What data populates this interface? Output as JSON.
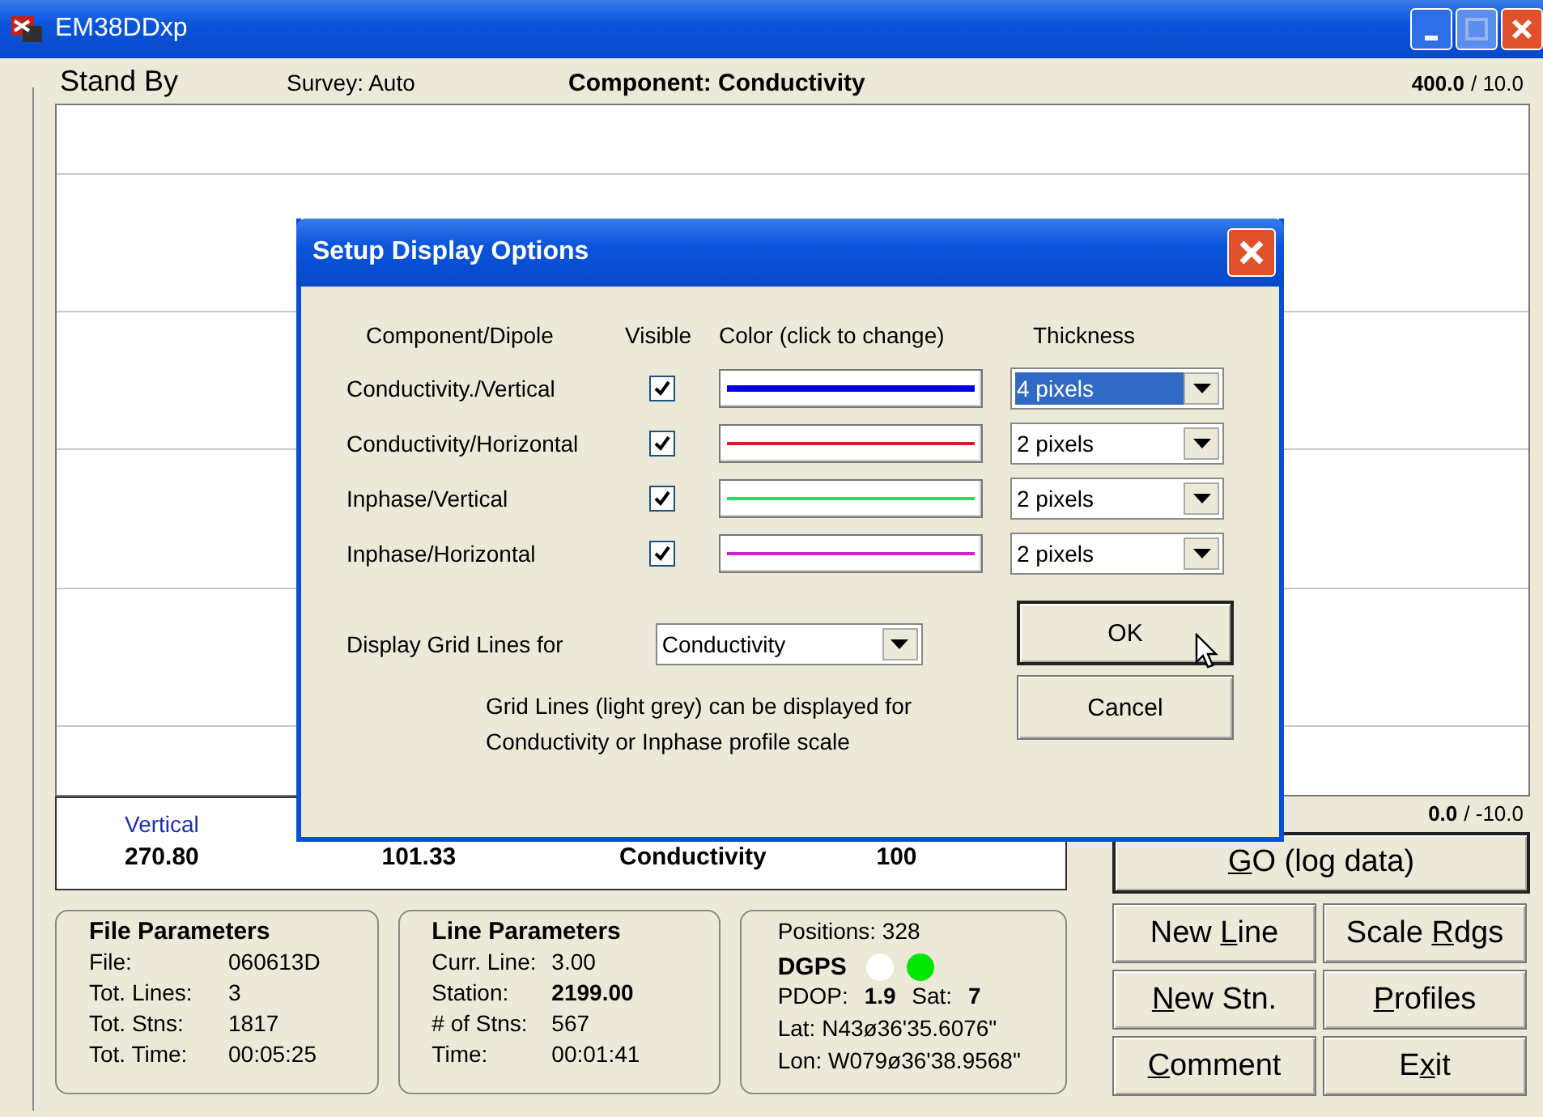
{
  "window": {
    "title": "EM38DDxp"
  },
  "header": {
    "status": "Stand By",
    "survey": "Survey: Auto",
    "component": "Component: Conductivity",
    "scale_top": {
      "value": "400.0",
      "range": "/ 10.0"
    }
  },
  "scale_bottom": {
    "value": "0.0",
    "range": "/ -10.0"
  },
  "readings": [
    {
      "heading": "Vertical",
      "value": "270.80"
    },
    {
      "value": "101.33"
    },
    {
      "value": "Conductivity"
    },
    {
      "value": "100"
    }
  ],
  "file_parameters": {
    "title": "File Parameters",
    "rows": [
      {
        "label": "File:",
        "value": "060613D",
        "bold": false
      },
      {
        "label": "Tot. Lines:",
        "value": "3",
        "bold": false
      },
      {
        "label": "Tot. Stns:",
        "value": "1817",
        "bold": false
      },
      {
        "label": "Tot. Time:",
        "value": "00:05:25",
        "bold": false
      }
    ]
  },
  "line_parameters": {
    "title": "Line Parameters",
    "rows": [
      {
        "label": "Curr. Line:",
        "value": "3.00",
        "bold": false
      },
      {
        "label": "Station:",
        "value": "2199.00",
        "bold": true
      },
      {
        "label": "# of Stns:",
        "value": "567",
        "bold": false
      },
      {
        "label": "Time:",
        "value": "00:01:41",
        "bold": false
      }
    ]
  },
  "gps": {
    "positions": "Positions: 328",
    "label": "DGPS",
    "lamps": [
      {
        "color": "#ffffff"
      },
      {
        "color": "#00e600"
      }
    ],
    "pdop": "PDOP: **1.9**    Sat: **7**",
    "lat": "Lat:  N43ø36'35.6076\"",
    "lon": "Lon: W079ø36'38.9568\""
  },
  "go_button": {
    "key": "G",
    "post": "O (log data)"
  },
  "buttons": [
    {
      "pre": "New ",
      "key": "L",
      "post": "ine"
    },
    {
      "pre": "Scale ",
      "key": "R",
      "post": "dgs"
    },
    {
      "key": "N",
      "post": "ew Stn."
    },
    {
      "key": "P",
      "post": "rofiles"
    },
    {
      "key": "C",
      "post": "omment"
    },
    {
      "pre": "E",
      "key": "x",
      "post": "it"
    }
  ],
  "dialog": {
    "title": "Setup Display Options",
    "columns": [
      "Component/Dipole",
      "Visible",
      "Color (click to change)",
      "Thickness"
    ],
    "rows": [
      {
        "label": "Conductivity./Vertical",
        "visible": true,
        "color": "#0000e6",
        "kind": "thick",
        "thickness": "4 pixels",
        "selected": true
      },
      {
        "label": "Conductivity/Horizontal",
        "visible": true,
        "color": "#d0202a",
        "kind": "thin",
        "thickness": "2 pixels",
        "selected": false
      },
      {
        "label": "Inphase/Vertical",
        "visible": true,
        "color": "#20e060",
        "kind": "thin",
        "thickness": "2 pixels",
        "selected": false
      },
      {
        "label": "Inphase/Horizontal",
        "visible": true,
        "color": "#d020d0",
        "kind": "thin",
        "thickness": "2 pixels",
        "selected": false
      }
    ],
    "grid_lines": {
      "label": "Display Grid Lines for",
      "value": "Conductivity"
    },
    "note": [
      "Grid Lines (light grey) can be displayed for",
      "Conductivity or Inphase profile scale"
    ],
    "ok": "OK",
    "cancel": "Cancel"
  }
}
